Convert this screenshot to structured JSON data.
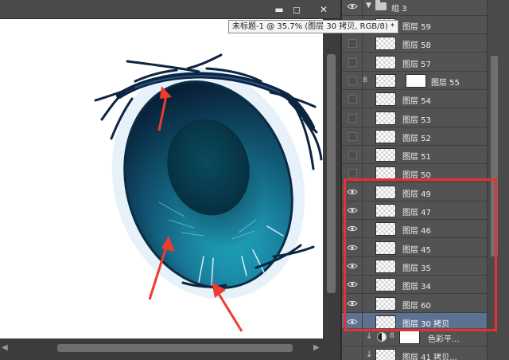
{
  "document": {
    "tooltip": "未标题-1 @ 35.7% (图层 30 拷贝, RGB/8) *",
    "buttons": {
      "minimize": "▬",
      "maximize": "◻",
      "close": "✕"
    }
  },
  "layers": {
    "group_name": "组 3",
    "rows": [
      {
        "name": "图层 59",
        "visible": false,
        "selected": false
      },
      {
        "name": "图层 58",
        "visible": false,
        "selected": false
      },
      {
        "name": "图层 57",
        "visible": false,
        "selected": false
      },
      {
        "name": "图层 55",
        "visible": false,
        "selected": false
      },
      {
        "name": "图层 54",
        "visible": false,
        "selected": false
      },
      {
        "name": "图层 53",
        "visible": false,
        "selected": false
      },
      {
        "name": "图层 52",
        "visible": false,
        "selected": false
      },
      {
        "name": "图层 51",
        "visible": false,
        "selected": false
      },
      {
        "name": "图层 50",
        "visible": false,
        "selected": false
      },
      {
        "name": "图层 49",
        "visible": true,
        "selected": false
      },
      {
        "name": "图层 47",
        "visible": true,
        "selected": false
      },
      {
        "name": "图层 46",
        "visible": true,
        "selected": false
      },
      {
        "name": "图层 45",
        "visible": true,
        "selected": false
      },
      {
        "name": "图层 35",
        "visible": true,
        "selected": false
      },
      {
        "name": "图层 34",
        "visible": true,
        "selected": false
      },
      {
        "name": "图层 60",
        "visible": true,
        "selected": false
      },
      {
        "name": "图层 30 拷贝",
        "visible": true,
        "selected": true
      }
    ],
    "adjustment_name": "色彩平...",
    "bottom_row": "图层 41 拷贝..."
  },
  "colors": {
    "highlight_box": "#e83030",
    "selected_row": "#5d7191",
    "arrows": "#ee3b2b"
  }
}
